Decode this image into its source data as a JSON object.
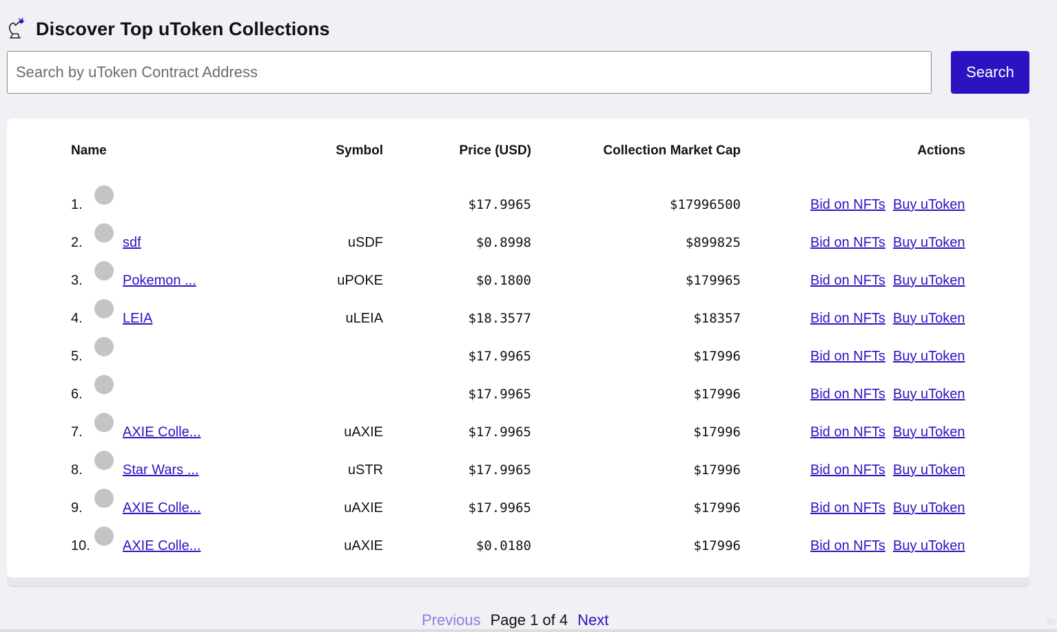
{
  "header": {
    "title": "Discover Top uToken Collections",
    "logo_icon": "genie-lamp-icon"
  },
  "search": {
    "placeholder": "Search by uToken Contract Address",
    "button_label": "Search"
  },
  "table": {
    "columns": {
      "name": "Name",
      "symbol": "Symbol",
      "price": "Price (USD)",
      "cap": "Collection Market Cap",
      "actions": "Actions"
    },
    "rows": [
      {
        "rank": "1.",
        "name": "",
        "symbol": "",
        "price": "$17.9965",
        "cap": "$17996500",
        "bid": "Bid on NFTs",
        "buy": "Buy uToken"
      },
      {
        "rank": "2.",
        "name": "sdf",
        "symbol": "uSDF",
        "price": "$0.8998",
        "cap": "$899825",
        "bid": "Bid on NFTs",
        "buy": "Buy uToken"
      },
      {
        "rank": "3.",
        "name": "Pokemon ...",
        "symbol": "uPOKE",
        "price": "$0.1800",
        "cap": "$179965",
        "bid": "Bid on NFTs",
        "buy": "Buy uToken"
      },
      {
        "rank": "4.",
        "name": "LEIA",
        "symbol": "uLEIA",
        "price": "$18.3577",
        "cap": "$18357",
        "bid": "Bid on NFTs",
        "buy": "Buy uToken"
      },
      {
        "rank": "5.",
        "name": "",
        "symbol": "",
        "price": "$17.9965",
        "cap": "$17996",
        "bid": "Bid on NFTs",
        "buy": "Buy uToken"
      },
      {
        "rank": "6.",
        "name": "",
        "symbol": "",
        "price": "$17.9965",
        "cap": "$17996",
        "bid": "Bid on NFTs",
        "buy": "Buy uToken"
      },
      {
        "rank": "7.",
        "name": "AXIE Colle...",
        "symbol": "uAXIE",
        "price": "$17.9965",
        "cap": "$17996",
        "bid": "Bid on NFTs",
        "buy": "Buy uToken"
      },
      {
        "rank": "8.",
        "name": "Star Wars ...",
        "symbol": "uSTR",
        "price": "$17.9965",
        "cap": "$17996",
        "bid": "Bid on NFTs",
        "buy": "Buy uToken"
      },
      {
        "rank": "9.",
        "name": "AXIE Colle...",
        "symbol": "uAXIE",
        "price": "$17.9965",
        "cap": "$17996",
        "bid": "Bid on NFTs",
        "buy": "Buy uToken"
      },
      {
        "rank": "10.",
        "name": "AXIE Colle...",
        "symbol": "uAXIE",
        "price": "$0.0180",
        "cap": "$17996",
        "bid": "Bid on NFTs",
        "buy": "Buy uToken"
      }
    ]
  },
  "pagination": {
    "previous": "Previous",
    "label": "Page 1 of 4",
    "next": "Next"
  },
  "corner_text": "83",
  "colors": {
    "accent": "#2c13c2",
    "page_bg": "#f0f0f5",
    "avatar": "#c4c4c4"
  }
}
